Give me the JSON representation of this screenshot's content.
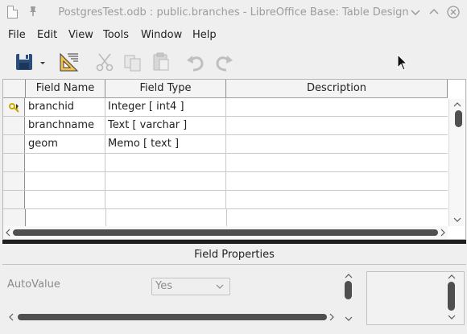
{
  "window": {
    "title": "PostgresTest.odb : public.branches - LibreOffice Base: Table Design",
    "icons": [
      "app-icon",
      "pin-icon",
      "minimize-icon",
      "maximize-icon",
      "close-icon"
    ]
  },
  "menu": [
    "File",
    "Edit",
    "View",
    "Tools",
    "Window",
    "Help"
  ],
  "toolbar": {
    "buttons": [
      {
        "name": "save",
        "icon": "floppy-disk-icon",
        "enabled": true
      },
      {
        "name": "save-dropdown",
        "icon": "chevron-down-icon",
        "enabled": true
      },
      {
        "name": "design-mode",
        "icon": "ruler-triangle-icon",
        "enabled": true
      },
      {
        "name": "cut",
        "icon": "scissors-icon",
        "enabled": false
      },
      {
        "name": "copy",
        "icon": "copy-icon",
        "enabled": false
      },
      {
        "name": "paste",
        "icon": "paste-icon",
        "enabled": false
      },
      {
        "name": "undo",
        "icon": "undo-icon",
        "enabled": false
      },
      {
        "name": "redo",
        "icon": "redo-icon",
        "enabled": false
      }
    ]
  },
  "grid": {
    "columns": [
      "Field Name",
      "Field Type",
      "Description"
    ],
    "rows": [
      {
        "field_name": "branchid",
        "field_type": "Integer [ int4 ]",
        "description": "",
        "primary_key": true
      },
      {
        "field_name": "branchname",
        "field_type": "Text [ varchar ]",
        "description": "",
        "primary_key": false
      },
      {
        "field_name": "geom",
        "field_type": "Memo [ text ]",
        "description": "",
        "primary_key": false
      },
      {
        "field_name": "",
        "field_type": "",
        "description": ""
      },
      {
        "field_name": "",
        "field_type": "",
        "description": ""
      },
      {
        "field_name": "",
        "field_type": "",
        "description": ""
      }
    ]
  },
  "field_properties": {
    "title": "Field Properties",
    "autovalue_label": "AutoValue",
    "autovalue_value": "Yes"
  },
  "colors": {
    "key_icon": "#c9a800",
    "splitter": "#1f1f1f",
    "scroll_thumb": "#4f4f4f"
  }
}
